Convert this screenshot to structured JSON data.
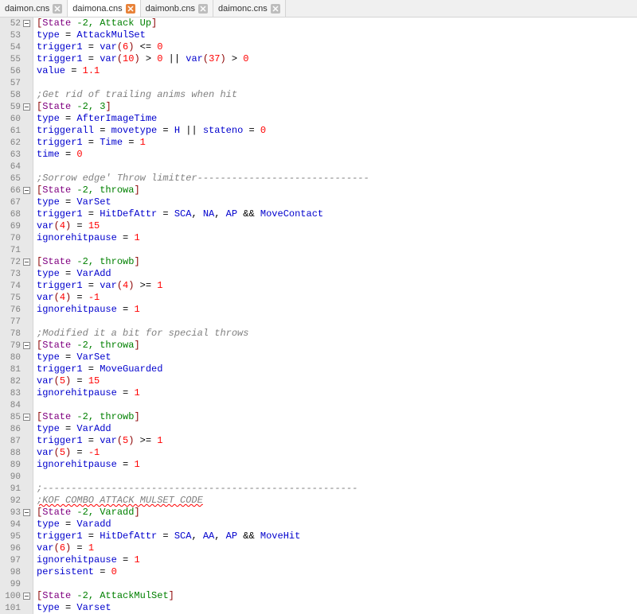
{
  "tabs": [
    {
      "label": "daimon.cns",
      "active": false,
      "closeStyle": "gray"
    },
    {
      "label": "daimona.cns",
      "active": true,
      "closeStyle": "orange"
    },
    {
      "label": "daimonb.cns",
      "active": false,
      "closeStyle": "gray"
    },
    {
      "label": "daimonc.cns",
      "active": false,
      "closeStyle": "gray"
    }
  ],
  "lines": [
    {
      "n": 52,
      "fold": true,
      "t": [
        [
          "dkred",
          "["
        ],
        [
          "purple",
          "State"
        ],
        [
          "black",
          " "
        ],
        [
          "green",
          "-2, Attack Up"
        ],
        [
          "dkred",
          "]"
        ]
      ]
    },
    {
      "n": 53,
      "t": [
        [
          "blue",
          "type"
        ],
        [
          "black",
          " = "
        ],
        [
          "blue",
          "AttackMulSet"
        ]
      ]
    },
    {
      "n": 54,
      "t": [
        [
          "blue",
          "trigger1"
        ],
        [
          "black",
          " = "
        ],
        [
          "blue",
          "var"
        ],
        [
          "dkred",
          "("
        ],
        [
          "red",
          "6"
        ],
        [
          "dkred",
          ")"
        ],
        [
          "black",
          " <= "
        ],
        [
          "red",
          "0"
        ]
      ]
    },
    {
      "n": 55,
      "t": [
        [
          "blue",
          "trigger1"
        ],
        [
          "black",
          " = "
        ],
        [
          "blue",
          "var"
        ],
        [
          "dkred",
          "("
        ],
        [
          "red",
          "10"
        ],
        [
          "dkred",
          ")"
        ],
        [
          "black",
          " > "
        ],
        [
          "red",
          "0"
        ],
        [
          "black",
          " || "
        ],
        [
          "blue",
          "var"
        ],
        [
          "dkred",
          "("
        ],
        [
          "red",
          "37"
        ],
        [
          "dkred",
          ")"
        ],
        [
          "black",
          " > "
        ],
        [
          "red",
          "0"
        ]
      ]
    },
    {
      "n": 56,
      "t": [
        [
          "blue",
          "value"
        ],
        [
          "black",
          " = "
        ],
        [
          "red",
          "1.1"
        ]
      ]
    },
    {
      "n": 57,
      "t": []
    },
    {
      "n": 58,
      "t": [
        [
          "gray",
          ";Get rid of trailing anims when hit"
        ]
      ]
    },
    {
      "n": 59,
      "fold": true,
      "t": [
        [
          "dkred",
          "["
        ],
        [
          "purple",
          "State"
        ],
        [
          "black",
          " "
        ],
        [
          "green",
          "-2, 3"
        ],
        [
          "dkred",
          "]"
        ]
      ]
    },
    {
      "n": 60,
      "t": [
        [
          "blue",
          "type"
        ],
        [
          "black",
          " = "
        ],
        [
          "blue",
          "AfterImageTime"
        ]
      ]
    },
    {
      "n": 61,
      "t": [
        [
          "blue",
          "triggerall"
        ],
        [
          "black",
          " = "
        ],
        [
          "blue",
          "movetype"
        ],
        [
          "black",
          " = "
        ],
        [
          "blue",
          "H"
        ],
        [
          "black",
          " || "
        ],
        [
          "blue",
          "stateno"
        ],
        [
          "black",
          " = "
        ],
        [
          "red",
          "0"
        ]
      ]
    },
    {
      "n": 62,
      "t": [
        [
          "blue",
          "trigger1"
        ],
        [
          "black",
          " = "
        ],
        [
          "blue",
          "Time"
        ],
        [
          "black",
          " = "
        ],
        [
          "red",
          "1"
        ]
      ]
    },
    {
      "n": 63,
      "t": [
        [
          "blue",
          "time"
        ],
        [
          "black",
          " = "
        ],
        [
          "red",
          "0"
        ]
      ]
    },
    {
      "n": 64,
      "t": []
    },
    {
      "n": 65,
      "t": [
        [
          "gray",
          ";Sorrow edge' Throw limitter------------------------------"
        ]
      ]
    },
    {
      "n": 66,
      "fold": true,
      "t": [
        [
          "dkred",
          "["
        ],
        [
          "purple",
          "State"
        ],
        [
          "black",
          " "
        ],
        [
          "green",
          "-2, throwa"
        ],
        [
          "dkred",
          "]"
        ]
      ]
    },
    {
      "n": 67,
      "t": [
        [
          "blue",
          "type"
        ],
        [
          "black",
          " = "
        ],
        [
          "blue",
          "VarSet"
        ]
      ]
    },
    {
      "n": 68,
      "t": [
        [
          "blue",
          "trigger1"
        ],
        [
          "black",
          " = "
        ],
        [
          "blue",
          "HitDefAttr"
        ],
        [
          "black",
          " = "
        ],
        [
          "blue",
          "SCA"
        ],
        [
          "black",
          ", "
        ],
        [
          "blue",
          "NA"
        ],
        [
          "black",
          ", "
        ],
        [
          "blue",
          "AP"
        ],
        [
          "black",
          " && "
        ],
        [
          "blue",
          "MoveContact"
        ]
      ]
    },
    {
      "n": 69,
      "t": [
        [
          "blue",
          "var"
        ],
        [
          "dkred",
          "("
        ],
        [
          "red",
          "4"
        ],
        [
          "dkred",
          ")"
        ],
        [
          "black",
          " = "
        ],
        [
          "red",
          "15"
        ]
      ]
    },
    {
      "n": 70,
      "t": [
        [
          "blue",
          "ignorehitpause"
        ],
        [
          "black",
          " = "
        ],
        [
          "red",
          "1"
        ]
      ]
    },
    {
      "n": 71,
      "t": []
    },
    {
      "n": 72,
      "fold": true,
      "t": [
        [
          "dkred",
          "["
        ],
        [
          "purple",
          "State"
        ],
        [
          "black",
          " "
        ],
        [
          "green",
          "-2, throwb"
        ],
        [
          "dkred",
          "]"
        ]
      ]
    },
    {
      "n": 73,
      "t": [
        [
          "blue",
          "type"
        ],
        [
          "black",
          " = "
        ],
        [
          "blue",
          "VarAdd"
        ]
      ]
    },
    {
      "n": 74,
      "t": [
        [
          "blue",
          "trigger1"
        ],
        [
          "black",
          " = "
        ],
        [
          "blue",
          "var"
        ],
        [
          "dkred",
          "("
        ],
        [
          "red",
          "4"
        ],
        [
          "dkred",
          ")"
        ],
        [
          "black",
          " >= "
        ],
        [
          "red",
          "1"
        ]
      ]
    },
    {
      "n": 75,
      "t": [
        [
          "blue",
          "var"
        ],
        [
          "dkred",
          "("
        ],
        [
          "red",
          "4"
        ],
        [
          "dkred",
          ")"
        ],
        [
          "black",
          " = "
        ],
        [
          "red",
          "-1"
        ]
      ]
    },
    {
      "n": 76,
      "t": [
        [
          "blue",
          "ignorehitpause"
        ],
        [
          "black",
          " = "
        ],
        [
          "red",
          "1"
        ]
      ]
    },
    {
      "n": 77,
      "t": []
    },
    {
      "n": 78,
      "t": [
        [
          "gray",
          ";Modified it a bit for special throws"
        ]
      ]
    },
    {
      "n": 79,
      "fold": true,
      "t": [
        [
          "dkred",
          "["
        ],
        [
          "purple",
          "State"
        ],
        [
          "black",
          " "
        ],
        [
          "green",
          "-2, throwa"
        ],
        [
          "dkred",
          "]"
        ]
      ]
    },
    {
      "n": 80,
      "t": [
        [
          "blue",
          "type"
        ],
        [
          "black",
          " = "
        ],
        [
          "blue",
          "VarSet"
        ]
      ]
    },
    {
      "n": 81,
      "t": [
        [
          "blue",
          "trigger1"
        ],
        [
          "black",
          " = "
        ],
        [
          "blue",
          "MoveGuarded"
        ]
      ]
    },
    {
      "n": 82,
      "t": [
        [
          "blue",
          "var"
        ],
        [
          "dkred",
          "("
        ],
        [
          "red",
          "5"
        ],
        [
          "dkred",
          ")"
        ],
        [
          "black",
          " = "
        ],
        [
          "red",
          "15"
        ]
      ]
    },
    {
      "n": 83,
      "t": [
        [
          "blue",
          "ignorehitpause"
        ],
        [
          "black",
          " = "
        ],
        [
          "red",
          "1"
        ]
      ]
    },
    {
      "n": 84,
      "t": []
    },
    {
      "n": 85,
      "fold": true,
      "t": [
        [
          "dkred",
          "["
        ],
        [
          "purple",
          "State"
        ],
        [
          "black",
          " "
        ],
        [
          "green",
          "-2, throwb"
        ],
        [
          "dkred",
          "]"
        ]
      ]
    },
    {
      "n": 86,
      "t": [
        [
          "blue",
          "type"
        ],
        [
          "black",
          " = "
        ],
        [
          "blue",
          "VarAdd"
        ]
      ]
    },
    {
      "n": 87,
      "t": [
        [
          "blue",
          "trigger1"
        ],
        [
          "black",
          " = "
        ],
        [
          "blue",
          "var"
        ],
        [
          "dkred",
          "("
        ],
        [
          "red",
          "5"
        ],
        [
          "dkred",
          ")"
        ],
        [
          "black",
          " >= "
        ],
        [
          "red",
          "1"
        ]
      ]
    },
    {
      "n": 88,
      "t": [
        [
          "blue",
          "var"
        ],
        [
          "dkred",
          "("
        ],
        [
          "red",
          "5"
        ],
        [
          "dkred",
          ")"
        ],
        [
          "black",
          " = "
        ],
        [
          "red",
          "-1"
        ]
      ]
    },
    {
      "n": 89,
      "t": [
        [
          "blue",
          "ignorehitpause"
        ],
        [
          "black",
          " = "
        ],
        [
          "red",
          "1"
        ]
      ]
    },
    {
      "n": 90,
      "t": []
    },
    {
      "n": 91,
      "t": [
        [
          "gray",
          ";-------------------------------------------------------"
        ]
      ]
    },
    {
      "n": 92,
      "wavy": true,
      "t": [
        [
          "gray",
          ";KOF COMBO ATTACK MULSET CODE"
        ]
      ]
    },
    {
      "n": 93,
      "fold": true,
      "t": [
        [
          "dkred",
          "["
        ],
        [
          "purple",
          "State"
        ],
        [
          "black",
          " "
        ],
        [
          "green",
          "-2, Varadd"
        ],
        [
          "dkred",
          "]"
        ]
      ]
    },
    {
      "n": 94,
      "t": [
        [
          "blue",
          "type"
        ],
        [
          "black",
          " = "
        ],
        [
          "blue",
          "Varadd"
        ]
      ]
    },
    {
      "n": 95,
      "t": [
        [
          "blue",
          "trigger1"
        ],
        [
          "black",
          " = "
        ],
        [
          "blue",
          "HitDefAttr"
        ],
        [
          "black",
          " = "
        ],
        [
          "blue",
          "SCA"
        ],
        [
          "black",
          ", "
        ],
        [
          "blue",
          "AA"
        ],
        [
          "black",
          ", "
        ],
        [
          "blue",
          "AP"
        ],
        [
          "black",
          " && "
        ],
        [
          "blue",
          "MoveHit"
        ]
      ]
    },
    {
      "n": 96,
      "t": [
        [
          "blue",
          "var"
        ],
        [
          "dkred",
          "("
        ],
        [
          "red",
          "6"
        ],
        [
          "dkred",
          ")"
        ],
        [
          "black",
          " = "
        ],
        [
          "red",
          "1"
        ]
      ]
    },
    {
      "n": 97,
      "t": [
        [
          "blue",
          "ignorehitpause"
        ],
        [
          "black",
          " = "
        ],
        [
          "red",
          "1"
        ]
      ]
    },
    {
      "n": 98,
      "t": [
        [
          "blue",
          "persistent"
        ],
        [
          "black",
          " = "
        ],
        [
          "red",
          "0"
        ]
      ]
    },
    {
      "n": 99,
      "t": []
    },
    {
      "n": 100,
      "fold": true,
      "t": [
        [
          "dkred",
          "["
        ],
        [
          "purple",
          "State"
        ],
        [
          "black",
          " "
        ],
        [
          "green",
          "-2, AttackMulSet"
        ],
        [
          "dkred",
          "]"
        ]
      ]
    },
    {
      "n": 101,
      "t": [
        [
          "blue",
          "type"
        ],
        [
          "black",
          " = "
        ],
        [
          "blue",
          "Varset"
        ]
      ]
    }
  ]
}
